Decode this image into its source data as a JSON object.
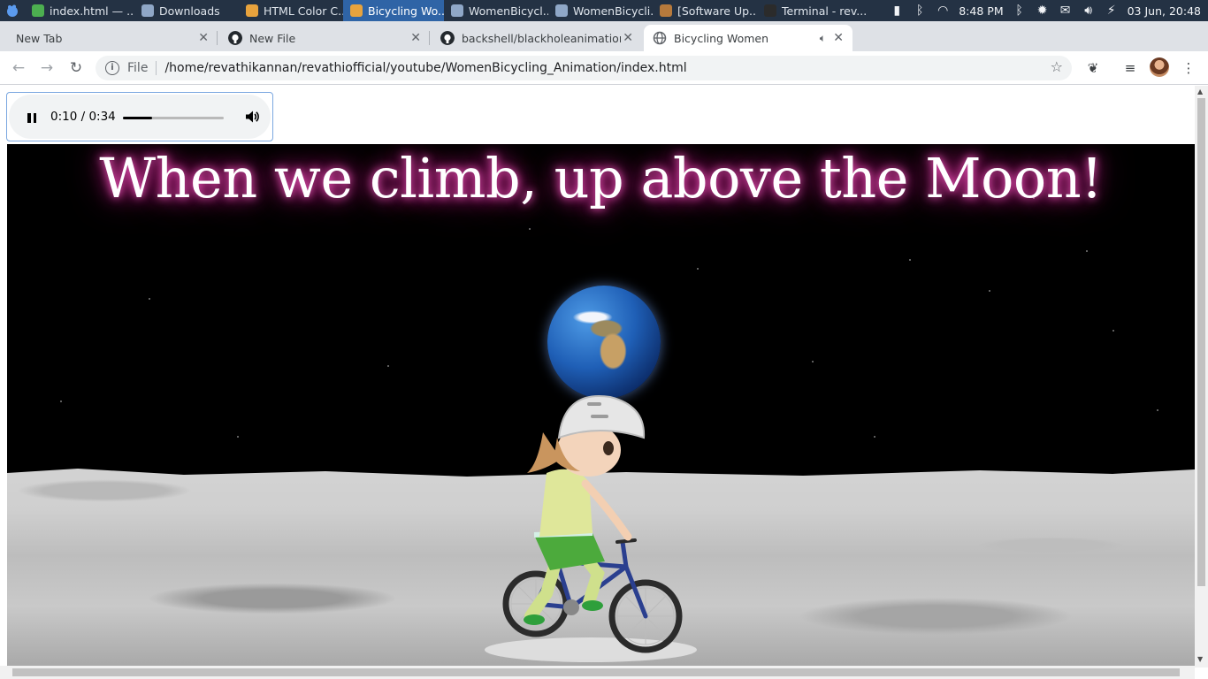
{
  "taskbar": {
    "menu_icon": "xfce-mouse-icon",
    "tasks": [
      {
        "label": "index.html — ...",
        "icon": "atom-icon",
        "color": "#4caf50"
      },
      {
        "label": "Downloads",
        "icon": "folder-icon",
        "color": "#8fa7c7"
      },
      {
        "label": "HTML Color C...",
        "icon": "chrome-icon",
        "color": "#e8a33d"
      },
      {
        "label": "Bicycling Wo...",
        "icon": "chrome-icon",
        "color": "#e8a33d"
      },
      {
        "label": "WomenBicycl...",
        "icon": "folder-icon",
        "color": "#8fa7c7"
      },
      {
        "label": "WomenBicycli...",
        "icon": "folder-icon",
        "color": "#8fa7c7"
      },
      {
        "label": "[Software Up...",
        "icon": "package-icon",
        "color": "#b77a3c"
      },
      {
        "label": "Terminal - rev...",
        "icon": "terminal-icon",
        "color": "#2b2b2b"
      }
    ],
    "active_task_index": 3,
    "clock": "8:48 PM",
    "date": "03 Jun, 20:48"
  },
  "tabs": [
    {
      "label": "New Tab",
      "icon": ""
    },
    {
      "label": "New File",
      "icon": "github-icon"
    },
    {
      "label": "backshell/blackholeanimation",
      "icon": "github-icon"
    },
    {
      "label": "Bicycling Women",
      "icon": "globe-icon",
      "audio": true
    }
  ],
  "toolbar": {
    "scheme": "File",
    "url": "/home/revathikannan/revathiofficial/youtube/WomenBicycling_Animation/index.html"
  },
  "audio": {
    "time": "0:10 / 0:34",
    "progress": 0.29
  },
  "page": {
    "headline": "When we climb, up above the Moon!"
  },
  "colors": {
    "accent": "#2f64a6",
    "glow": "#e0259e"
  }
}
